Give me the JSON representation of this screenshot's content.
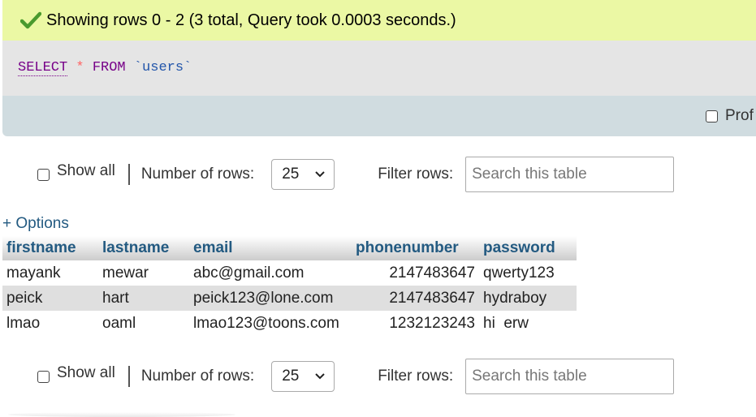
{
  "message": {
    "text": "Showing rows 0 - 2 (3 total, Query took 0.0003 seconds.)",
    "icon": "check-icon",
    "colors": {
      "bg": "#ebf8a4",
      "check": "#4a9a2e"
    }
  },
  "query": {
    "select_kw": "SELECT",
    "star": "*",
    "from_kw": "FROM",
    "table": "`users`"
  },
  "profiling": {
    "label": "Prof"
  },
  "nav_top": {
    "show_all": "Show all",
    "rows_label": "Number of rows:",
    "rows_value": "25",
    "filter_label": "Filter rows:",
    "search_placeholder": "Search this table"
  },
  "nav_bottom": {
    "show_all": "Show all",
    "rows_label": "Number of rows:",
    "rows_value": "25",
    "filter_label": "Filter rows:",
    "search_placeholder": "Search this table"
  },
  "options": {
    "label": "+ Options"
  },
  "table": {
    "headers": [
      "firstname",
      "lastname",
      "email",
      "phonenumber",
      "password"
    ],
    "rows": [
      [
        "mayank",
        "mewar",
        "abc@gmail.com",
        "2147483647",
        "qwerty123"
      ],
      [
        "peick",
        "hart",
        "peick123@lone.com",
        "2147483647",
        "hydraboy"
      ],
      [
        "lmao",
        "oaml",
        "lmao123@toons.com",
        "1232123243",
        "hi  erw"
      ]
    ]
  }
}
